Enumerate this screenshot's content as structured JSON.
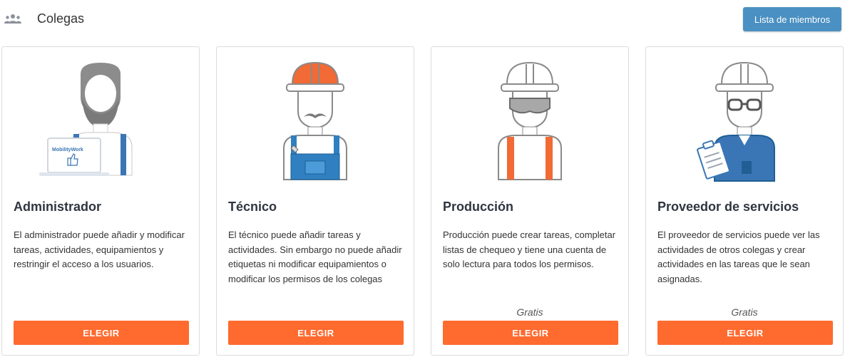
{
  "header": {
    "title": "Colegas",
    "members_button": "Lista de miembros"
  },
  "cards": [
    {
      "title": "Administrador",
      "description": "El administrador puede añadir y modificar tareas, actividades, equipamientos y restringir el acceso a los usuarios.",
      "price": "",
      "button": "ELEGIR",
      "laptop_logo": "MobilityWork",
      "icon": "admin-avatar-icon"
    },
    {
      "title": "Técnico",
      "description": "El técnico puede añadir tareas y actividades. Sin embargo no puede añadir etiquetas ni modificar equipamientos o modificar los permisos de los colegas",
      "price": "",
      "button": "ELEGIR",
      "icon": "technician-avatar-icon"
    },
    {
      "title": "Producción",
      "description": "Producción puede crear tareas, completar listas de chequeo y tiene una cuenta de solo lectura para todos los permisos.",
      "price": "Gratis",
      "button": "ELEGIR",
      "icon": "production-avatar-icon"
    },
    {
      "title": "Proveedor de servicios",
      "description": "El proveedor de servicios puede ver las actividades de otros colegas y crear actividades en las tareas que le sean asignadas.",
      "price": "Gratis",
      "button": "ELEGIR",
      "icon": "service-provider-avatar-icon"
    }
  ],
  "colors": {
    "accent_button": "#ff6a2f",
    "header_button": "#4a90c2",
    "helmet_orange": "#f26a35",
    "overall_blue": "#2f7fc1"
  }
}
